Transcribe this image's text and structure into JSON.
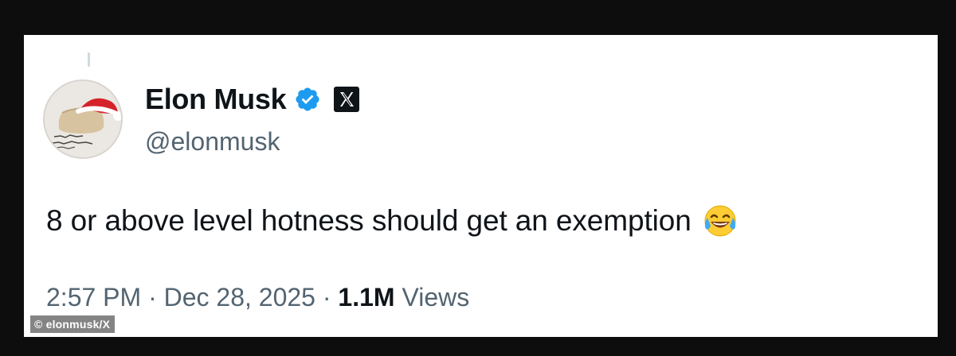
{
  "tweet": {
    "author_name": "Elon Musk",
    "handle": "@elonmusk",
    "text": "8 or above level hotness should get an exemption",
    "emoji": "face-with-tears-of-joy",
    "time": "2:57 PM",
    "separator": "·",
    "date": "Dec 28, 2025",
    "views_count": "1.1M",
    "views_label": "Views"
  },
  "icons": {
    "verified": "verified-badge-icon",
    "affiliate": "x-logo-icon"
  },
  "colors": {
    "verified_blue": "#1d9bf0",
    "text_primary": "#0f1419",
    "text_secondary": "#536471"
  },
  "credit": "© elonmusk/X"
}
